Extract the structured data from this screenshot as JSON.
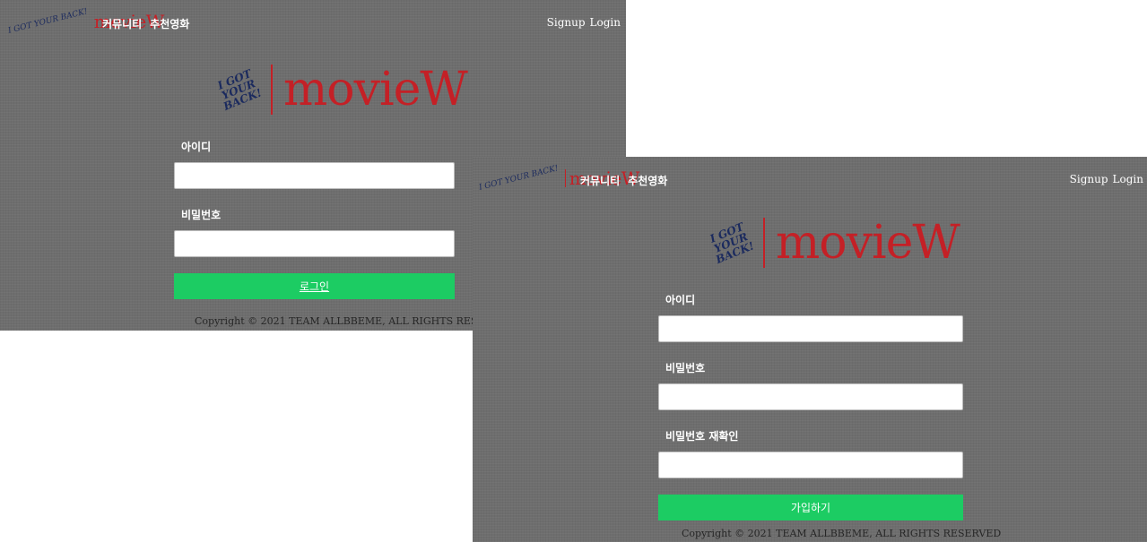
{
  "brand": {
    "name": "movieW",
    "tagline": "I GOT YOUR BACK!",
    "colors": {
      "brand_red": "#c42026",
      "button_green": "#1ccc63",
      "panel_bg": "#6e6e6e"
    }
  },
  "nav": {
    "links": [
      "커뮤니티",
      "추천영화"
    ],
    "signup": "Signup",
    "login": "Login"
  },
  "login_form": {
    "id_label": "아이디",
    "pw_label": "비밀번호",
    "submit": "로그인"
  },
  "signup_form": {
    "id_label": "아이디",
    "pw_label": "비밀번호",
    "pw_confirm_label": "비밀번호 재확인",
    "submit": "가입하기"
  },
  "footer": {
    "copyright": "Copyright © 2021 TEAM ALLBBEME, ALL RIGHTS RESERVED"
  },
  "icons": {
    "logo": "signature-logo-icon"
  }
}
